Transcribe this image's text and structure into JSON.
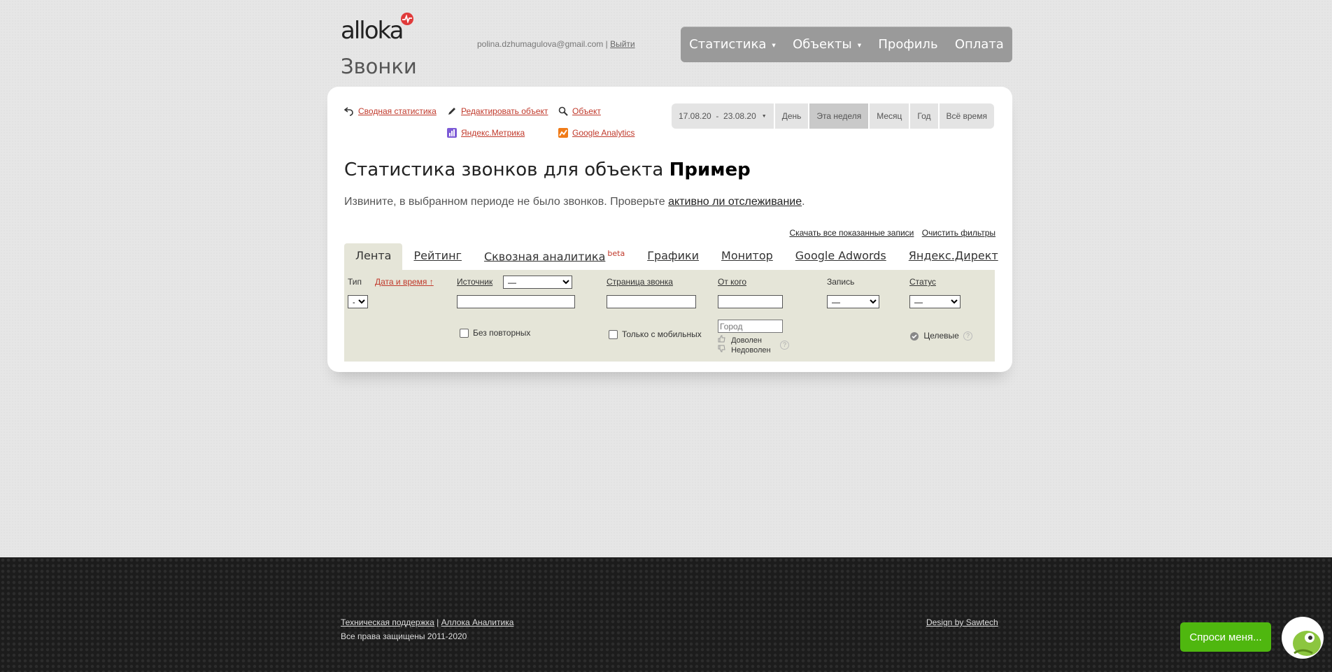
{
  "header": {
    "logo_text": "alloka",
    "page_title": "Звонки",
    "user_email": "polina.dzhumagulova@gmail.com",
    "separator": "|",
    "logout": "Выйти"
  },
  "topnav": {
    "items": [
      {
        "label": "Статистика",
        "has_caret": true
      },
      {
        "label": "Объекты",
        "has_caret": true
      },
      {
        "label": "Профиль",
        "has_caret": false
      },
      {
        "label": "Оплата",
        "has_caret": false
      }
    ],
    "caret": "▼"
  },
  "links": {
    "summary": "Сводная статистика",
    "edit_object": "Редактировать объект",
    "object": "Объект",
    "yandex_metrika": "Яндекс.Метрика",
    "google_analytics": "Google Analytics"
  },
  "period": {
    "range": "17.08.20  -  23.08.20",
    "caret": "▼",
    "day": "День",
    "this_week": "Эта неделя",
    "month": "Месяц",
    "year": "Год",
    "all_time": "Всё время",
    "active": "Эта неделя"
  },
  "main": {
    "title_prefix": "Статистика звонков для объекта",
    "title_object": "Пример",
    "notice_text": "Извините, в выбранном периоде не было звонков. Проверьте",
    "notice_link": "активно ли отслеживание",
    "notice_end": ".",
    "download_all": "Скачать все показанные записи",
    "clear_filters": "Очистить фильтры"
  },
  "tabs": {
    "feed": "Лента",
    "rating": "Рейтинг",
    "through": "Сквозная аналитика",
    "through_badge": "beta",
    "charts": "Графики",
    "monitor": "Монитор",
    "adwords": "Google Adwords",
    "direct": "Яндекс.Директ"
  },
  "filters": {
    "type_label": "Тип",
    "type_value": "-",
    "datetime_label": "Дата и время ↑",
    "source_label": "Источник",
    "source_value": "—",
    "no_repeats": "Без повторных",
    "page_label": "Страница звонка",
    "only_mobile": "Только с мобильных",
    "from_label": "От кого",
    "city_placeholder": "Город",
    "satisfied": "Доволен",
    "unsatisfied": "Недоволен",
    "record_label": "Запись",
    "record_value": "—",
    "status_label": "Статус",
    "status_value": "—",
    "targeted": "Целевые",
    "help": "?"
  },
  "footer": {
    "support": "Техническая поддержка",
    "separator": "|",
    "analytics": "Аллока Аналитика",
    "rights": "Все права защищены 2011-2020",
    "design": "Design by Sawtech"
  },
  "chat": {
    "ask_label": "Спроси меня..."
  },
  "colors": {
    "accent_red": "#c0392b",
    "nav_bg": "#9a9a9a",
    "filter_bg": "#e5e5d8",
    "chat_green": "#4fb70f",
    "footer_bg": "#1c1c1c"
  }
}
